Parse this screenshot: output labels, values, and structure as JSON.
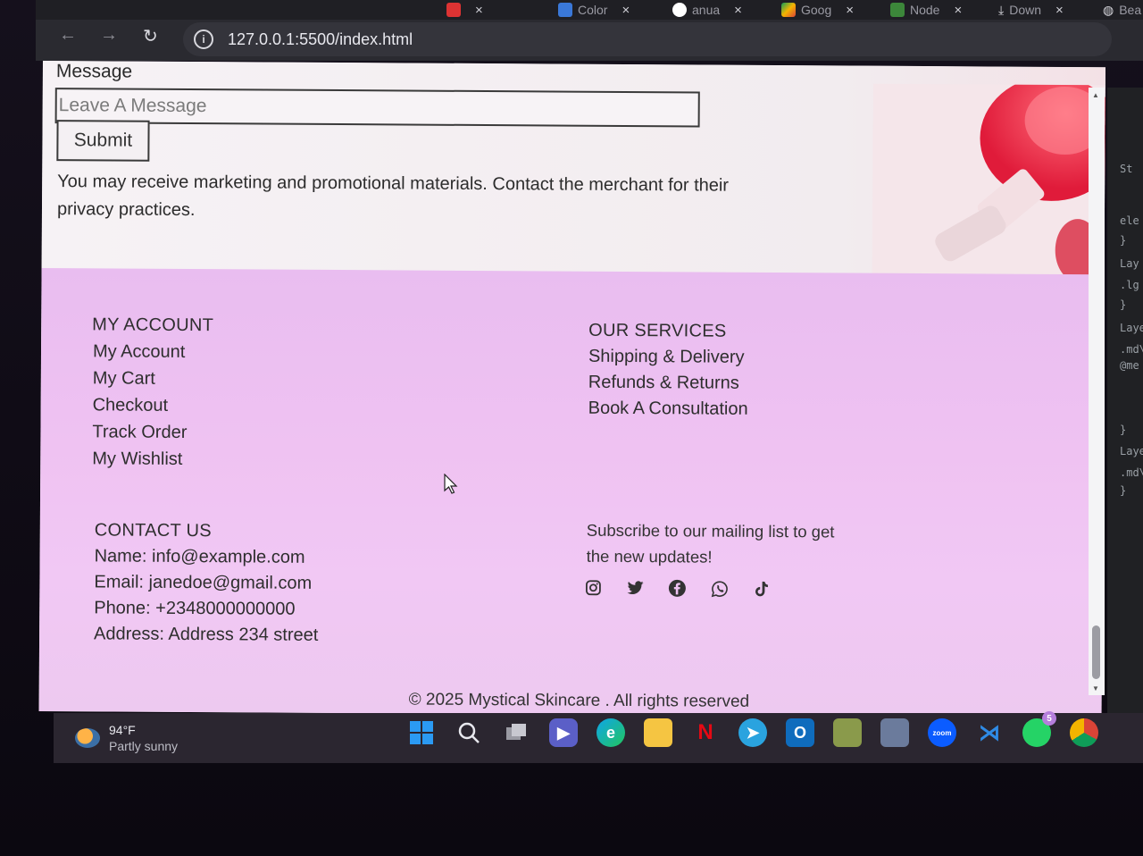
{
  "browser": {
    "tabs": [
      {
        "label": "Color",
        "icon": "vscode-blue-icon",
        "color": "#3a78d8"
      },
      {
        "label": "anua",
        "icon": "google-icon",
        "color": "#4285f4"
      },
      {
        "label": "Goog",
        "icon": "google-drive-icon",
        "color": "#f4b400"
      },
      {
        "label": "Node",
        "icon": "node-icon",
        "color": "#3c873a"
      },
      {
        "label": "Down",
        "icon": "download-icon",
        "color": "#d8d8de"
      },
      {
        "label": "Bea",
        "icon": "globe-icon",
        "color": "#d8d8de"
      }
    ],
    "tab_close": "×",
    "url": "127.0.0.1:5500/index.html"
  },
  "contact_form": {
    "message_label": "Message",
    "message_placeholder": "Leave A Message",
    "submit_label": "Submit",
    "privacy_text": "You may receive marketing and promotional materials. Contact the merchant for their privacy practices."
  },
  "footer": {
    "my_account": {
      "heading": "MY ACCOUNT",
      "links": [
        "My Account",
        "My Cart",
        "Checkout",
        "Track Order",
        "My Wishlist"
      ]
    },
    "our_services": {
      "heading": "OUR SERVICES",
      "links": [
        "Shipping & Delivery",
        "Refunds & Returns",
        "Book A Consultation"
      ]
    },
    "contact_us": {
      "heading": "CONTACT US",
      "lines": [
        "Name: info@example.com",
        "Email: janedoe@gmail.com",
        "Phone: +2348000000000",
        "Address: Address 234 street"
      ]
    },
    "subscribe_text": "Subscribe to our mailing list to get the new updates!",
    "socials": [
      "instagram-icon",
      "twitter-icon",
      "facebook-icon",
      "whatsapp-icon",
      "tiktok-icon"
    ],
    "copyright": "© 2025 Mystical Skincare . All rights reserved"
  },
  "devtools": {
    "lines": [
      "St",
      "ele",
      "}",
      "Lay",
      ".lg",
      "}",
      "Laye",
      ".md\\",
      "@me",
      "}",
      "Laye",
      ".md\\",
      "}"
    ]
  },
  "taskbar": {
    "temperature": "94°F",
    "condition": "Partly sunny",
    "app_icons": [
      "windows-start-icon",
      "search-icon",
      "task-view-icon",
      "teams-icon",
      "edge-icon",
      "file-explorer-icon",
      "netflix-icon",
      "telegram-icon",
      "outlook-icon",
      "game-icon",
      "photos-icon",
      "zoom-icon",
      "vscode-icon",
      "whatsapp-icon",
      "chrome-icon"
    ],
    "whatsapp_badge": "5"
  },
  "colors": {
    "footer_pink": "#efc2f2",
    "page_bg": "#f3eef2",
    "text": "#2e2e2e"
  }
}
